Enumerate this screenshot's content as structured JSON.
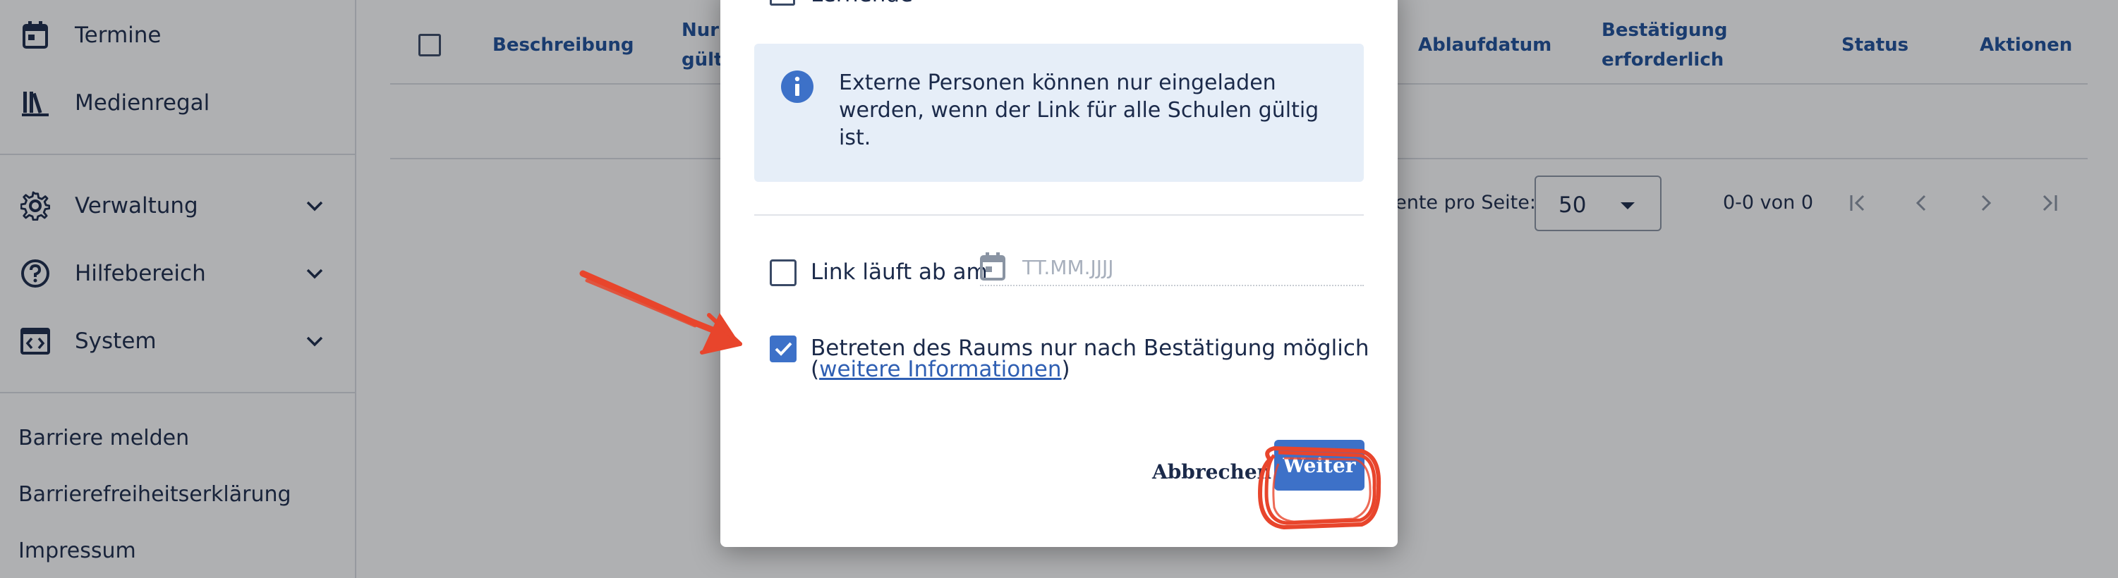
{
  "sidebar": {
    "items": [
      {
        "label": "Termine",
        "icon": "calendar-icon"
      },
      {
        "label": "Medienregal",
        "icon": "bookshelf-icon"
      },
      {
        "label": "Verwaltung",
        "icon": "gear-icon"
      },
      {
        "label": "Hilfebereich",
        "icon": "help-circle-icon"
      },
      {
        "label": "System",
        "icon": "code-window-icon"
      }
    ],
    "footer_links": [
      "Barriere melden",
      "Barrierefreiheitserklärung",
      "Impressum"
    ]
  },
  "table": {
    "headers": {
      "beschreibung": "Beschreibung",
      "nur_schule_line1": "Nur s",
      "nur_schule_line2": "gülti",
      "ablaufdatum": "Ablaufdatum",
      "bestaetigung_line1": "Bestätigung",
      "bestaetigung_line2": "erforderlich",
      "status": "Status",
      "aktionen": "Aktionen"
    }
  },
  "pagination": {
    "per_page_label": "nente pro Seite:",
    "per_page_value": "50",
    "range": "0-0 von 0"
  },
  "dialog": {
    "top_checkbox_label": "Lernende",
    "info_text": "Externe Personen können nur eingeladen werden, wenn der Link für alle Schulen gültig ist.",
    "expiry_label": "Link läuft ab am",
    "date_placeholder": "TT.MM.JJJJ",
    "confirm_label": "Betreten des Raums nur nach Bestätigung möglich",
    "more_info_link": "weitere Informationen",
    "paren_open": "(",
    "paren_close": ")",
    "cancel_label": "Abbrechen",
    "next_label": "Weiter"
  },
  "colors": {
    "accent": "#3d71c8",
    "heading_blue": "#1d4f9a",
    "annotation_red": "#e8452c"
  }
}
